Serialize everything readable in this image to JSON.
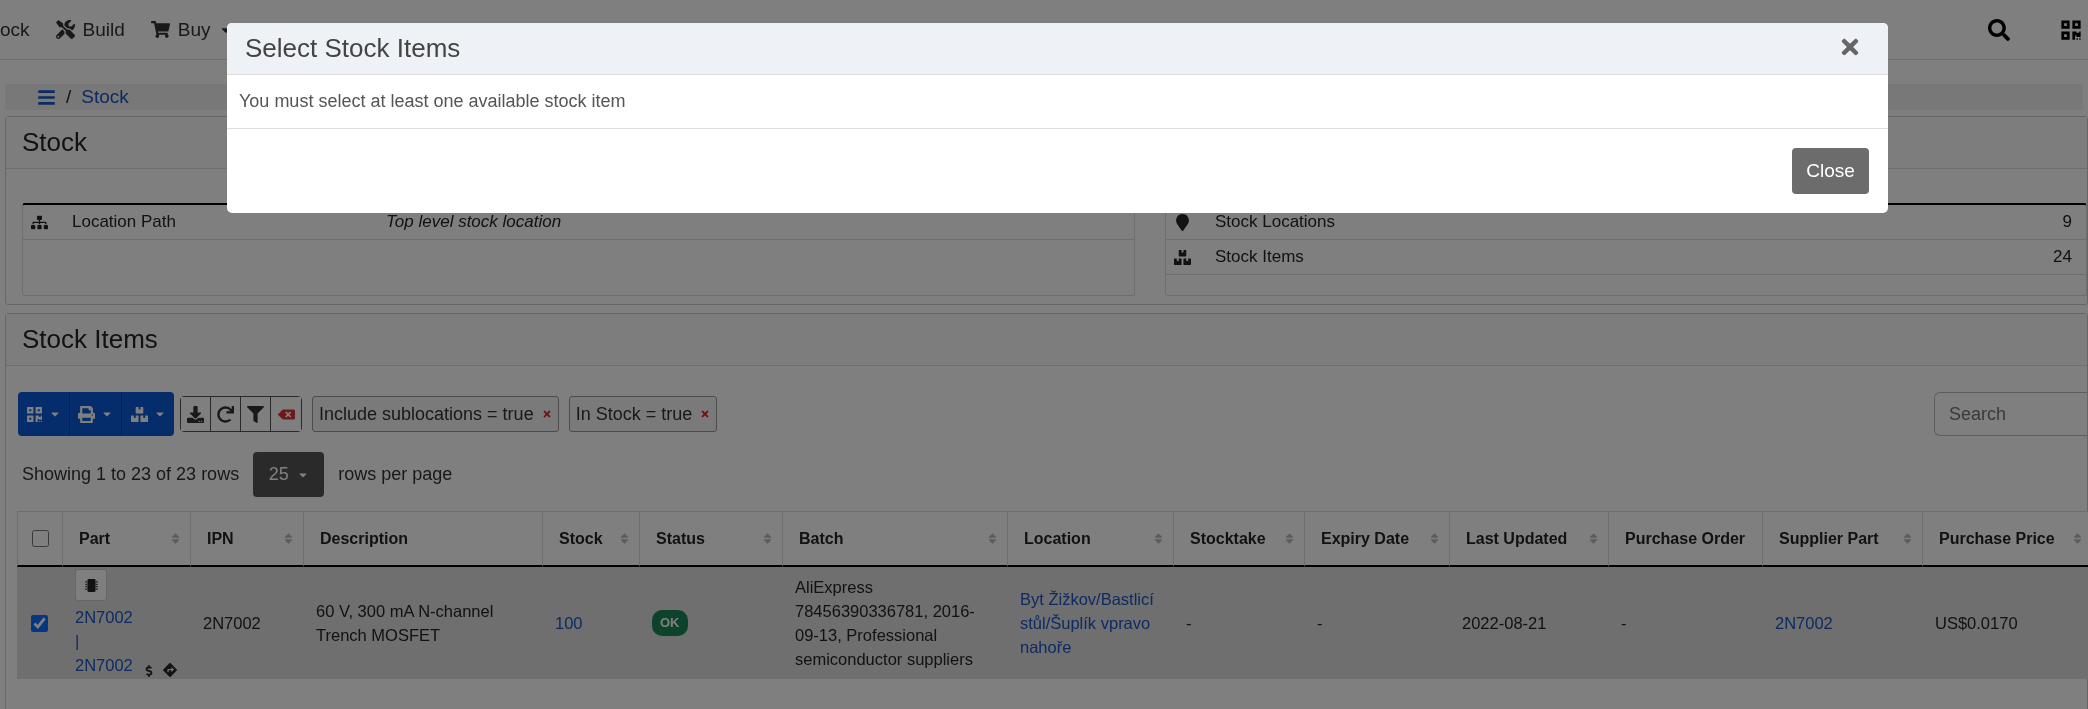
{
  "navbar": {
    "items": [
      {
        "label": "ock",
        "dropdown": false
      },
      {
        "label": "Build",
        "dropdown": false
      },
      {
        "label": "Buy",
        "dropdown": true
      }
    ]
  },
  "breadcrumb": {
    "separator": "/",
    "items": [
      "Stock"
    ]
  },
  "stock_panel": {
    "title": "Stock",
    "location_path": {
      "label": "Location Path",
      "value": "Top level stock location"
    },
    "summary": [
      {
        "label": "Stock Locations",
        "count": "9"
      },
      {
        "label": "Stock Items",
        "count": "24"
      }
    ]
  },
  "items_panel": {
    "title": "Stock Items",
    "filters": [
      {
        "label": "Include sublocations = true"
      },
      {
        "label": "In Stock = true"
      }
    ],
    "search": {
      "placeholder": "Search"
    },
    "pagination": {
      "text": "Showing 1 to 23 of 23 rows",
      "page_size": "25",
      "suffix": "rows per page"
    },
    "table": {
      "select_all": {
        "checked": false
      },
      "columns": [
        {
          "label": "Part",
          "sortable": true
        },
        {
          "label": "IPN",
          "sortable": true
        },
        {
          "label": "Description",
          "sortable": false
        },
        {
          "label": "Stock",
          "sortable": true
        },
        {
          "label": "Status",
          "sortable": true
        },
        {
          "label": "Batch",
          "sortable": true
        },
        {
          "label": "Location",
          "sortable": true
        },
        {
          "label": "Stocktake",
          "sortable": true
        },
        {
          "label": "Expiry Date",
          "sortable": true
        },
        {
          "label": "Last Updated",
          "sortable": true
        },
        {
          "label": "Purchase Order",
          "sortable": false
        },
        {
          "label": "Supplier Part",
          "sortable": true
        },
        {
          "label": "Purchase Price",
          "sortable": true
        }
      ],
      "rows": [
        {
          "checked": true,
          "cells": [
            {
              "kind": "part",
              "text": "2N7002 | 2N7002"
            },
            {
              "kind": "text",
              "text": "2N7002"
            },
            {
              "kind": "text",
              "text": "60 V, 300 mA N-channel Trench MOSFET"
            },
            {
              "kind": "link",
              "text": "100"
            },
            {
              "kind": "badge",
              "text": "OK"
            },
            {
              "kind": "text",
              "text": "AliExpress 78456390336781, 2016-09-13, Professional semiconductor suppliers"
            },
            {
              "kind": "link",
              "text": "Byt Žižkov/Bastlicí stůl/Šuplík vpravo nahoře"
            },
            {
              "kind": "text",
              "text": "-"
            },
            {
              "kind": "text",
              "text": "-"
            },
            {
              "kind": "text",
              "text": "2022-08-21"
            },
            {
              "kind": "text",
              "text": "-"
            },
            {
              "kind": "link",
              "text": "2N7002"
            },
            {
              "kind": "text",
              "text": "US$0.0170"
            }
          ]
        }
      ]
    }
  },
  "modal": {
    "title": "Select Stock Items",
    "message": "You must select at least one available stock item",
    "button": "Close"
  }
}
